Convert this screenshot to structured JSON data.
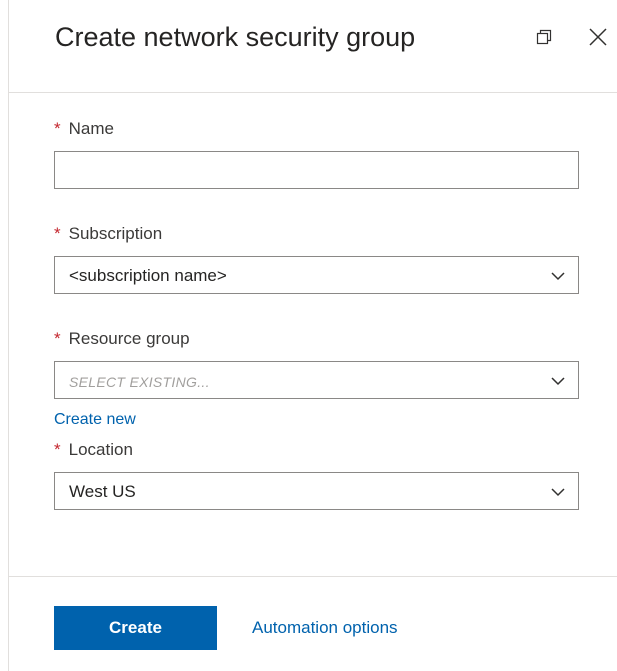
{
  "blade": {
    "title": "Create network security group",
    "restore_icon": "restore-window-icon",
    "close_icon": "close-icon"
  },
  "form": {
    "required_marker": "*",
    "name": {
      "label": "Name",
      "value": "",
      "placeholder": ""
    },
    "subscription": {
      "label": "Subscription",
      "selected": "<subscription name>"
    },
    "resource_group": {
      "label": "Resource group",
      "selected": "SELECT EXISTING...",
      "create_new_link": "Create new"
    },
    "location": {
      "label": "Location",
      "selected": "West US"
    }
  },
  "footer": {
    "create_label": "Create",
    "automation_label": "Automation options"
  },
  "colors": {
    "primary": "#0062ad",
    "required": "#c4262e",
    "border": "#8a8886"
  }
}
